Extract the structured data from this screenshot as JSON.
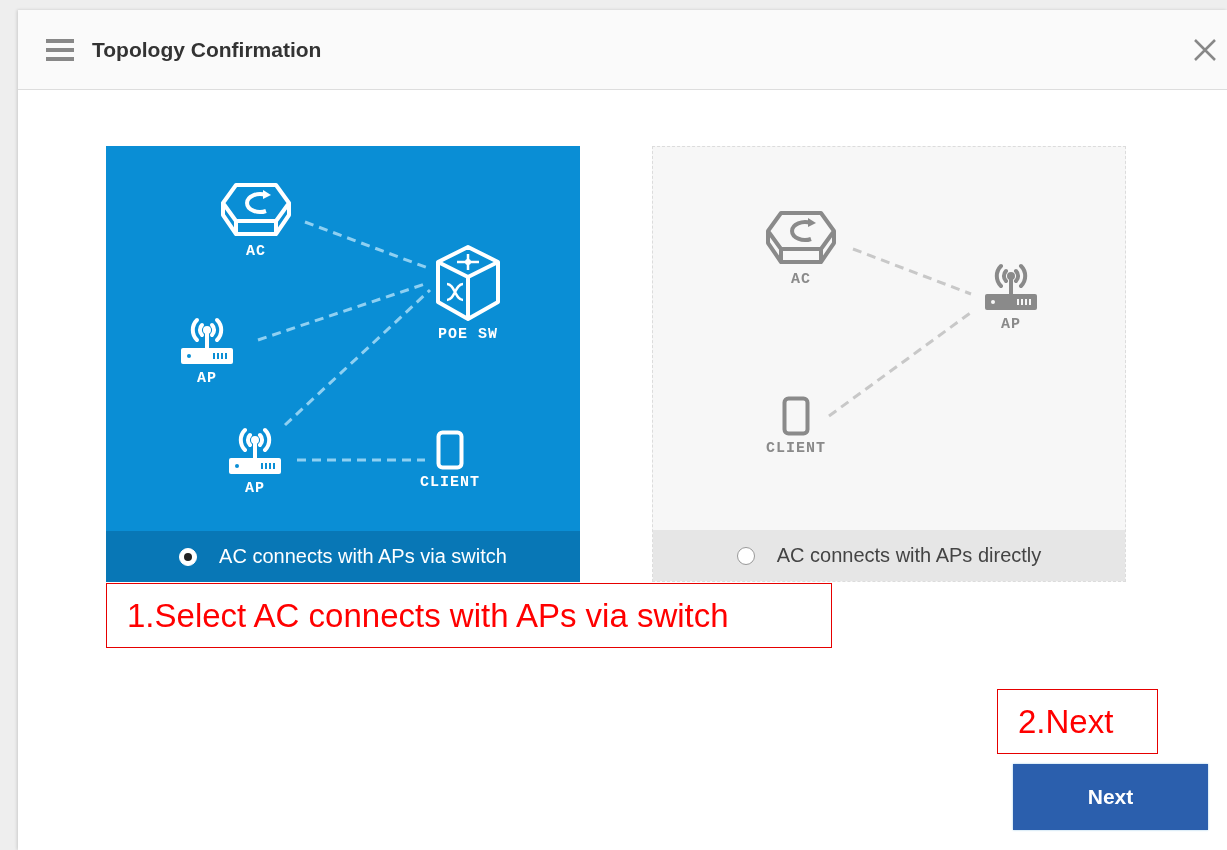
{
  "dialog": {
    "title": "Topology Confirmation"
  },
  "options": [
    {
      "label": "AC connects with APs via switch",
      "selected": true,
      "nodes": [
        {
          "kind": "ac",
          "label": "AC"
        },
        {
          "kind": "switch",
          "label": "POE SW"
        },
        {
          "kind": "ap",
          "label": "AP"
        },
        {
          "kind": "ap",
          "label": "AP"
        },
        {
          "kind": "client",
          "label": "CLIENT"
        }
      ]
    },
    {
      "label": "AC connects with APs directly",
      "selected": false,
      "nodes": [
        {
          "kind": "ac",
          "label": "AC"
        },
        {
          "kind": "ap",
          "label": "AP"
        },
        {
          "kind": "client",
          "label": "CLIENT"
        }
      ]
    }
  ],
  "annotations": [
    {
      "text": "1.Select AC connects with APs via switch"
    },
    {
      "text": "2.Next"
    }
  ],
  "next_button": {
    "label": "Next"
  }
}
